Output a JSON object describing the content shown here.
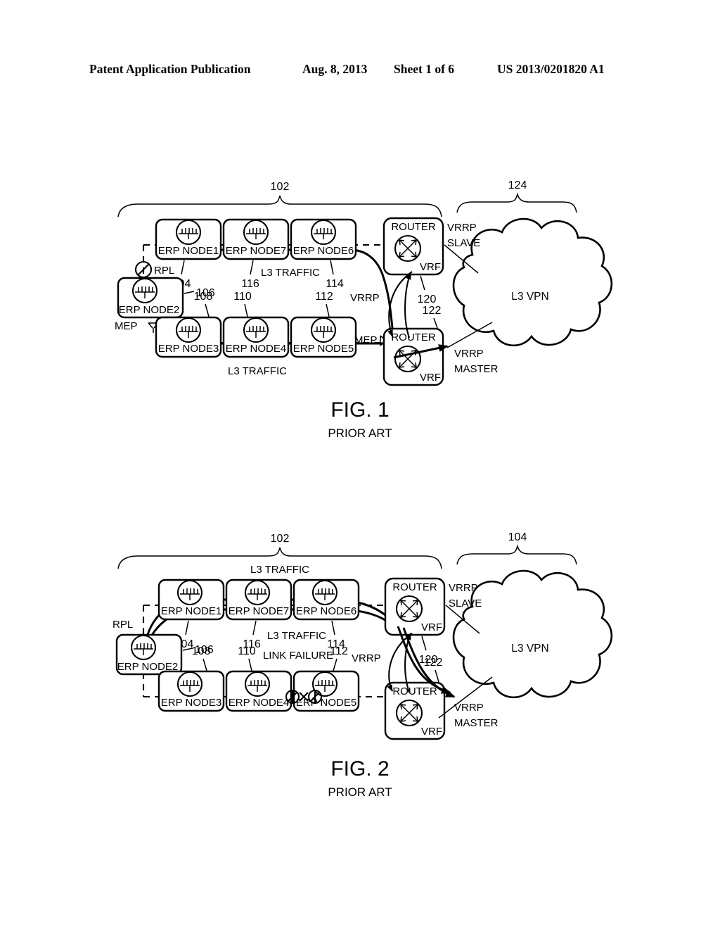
{
  "header": {
    "publication": "Patent Application Publication",
    "date": "Aug. 8, 2013",
    "sheet": "Sheet 1 of 6",
    "patent_number": "US 2013/0201820 A1"
  },
  "figures": [
    {
      "id": "fig1",
      "caption": "FIG. 1",
      "caption_sub": "PRIOR ART",
      "ring_ref": "102",
      "cloud_ref": "124",
      "cloud_label": "L3 VPN",
      "rpl_label": "RPL",
      "vrrp_label": "VRRP",
      "vrrp_slave": "VRRP\nSLAVE",
      "vrrp_slave_line1": "VRRP",
      "vrrp_slave_line2": "SLAVE",
      "vrrp_master_line1": "VRRP",
      "vrrp_master_line2": "MASTER",
      "mep_left": "MEP",
      "mep_right": "MEP",
      "traffic_label_top": "L3 TRAFFIC",
      "traffic_label_bottom": "L3 TRAFFIC",
      "nodes_top": [
        {
          "label": "ERP NODE1",
          "ref": "104"
        },
        {
          "label": "ERP NODE7",
          "ref": "116"
        },
        {
          "label": "ERP NODE6",
          "ref": "114"
        }
      ],
      "nodes_bottom": [
        {
          "label": "ERP NODE3",
          "ref": "108"
        },
        {
          "label": "ERP NODE4",
          "ref": "110"
        },
        {
          "label": "ERP NODE5",
          "ref": "112"
        }
      ],
      "node_left": {
        "label": "ERP NODE2",
        "ref": "106"
      },
      "routers": [
        {
          "label": "ROUTER",
          "vrf": "VRF",
          "ref": "120"
        },
        {
          "label": "ROUTER",
          "vrf": "VRF",
          "ref": "122"
        }
      ]
    },
    {
      "id": "fig2",
      "caption": "FIG. 2",
      "caption_sub": "PRIOR ART",
      "ring_ref": "102",
      "cloud_ref": "104",
      "cloud_label": "L3 VPN",
      "rpl_label": "RPL",
      "vrrp_label": "VRRP",
      "vrrp_slave_line1": "VRRP",
      "vrrp_slave_line2": "SLAVE",
      "vrrp_master_line1": "VRRP",
      "vrrp_master_line2": "MASTER",
      "traffic_label_above": "L3 TRAFFIC",
      "traffic_label_mid": "L3 TRAFFIC",
      "link_failure_label": "LINK FAILURE",
      "nodes_top": [
        {
          "label": "ERP NODE1",
          "ref": "104"
        },
        {
          "label": "ERP NODE7",
          "ref": "116"
        },
        {
          "label": "ERP NODE6",
          "ref": "114"
        }
      ],
      "nodes_bottom": [
        {
          "label": "ERP NODE3",
          "ref": "108"
        },
        {
          "label": "ERP NODE4",
          "ref": "110"
        },
        {
          "label": "ERP NODE5",
          "ref": "112"
        }
      ],
      "node_left": {
        "label": "ERP NODE2",
        "ref": "106"
      },
      "routers": [
        {
          "label": "ROUTER",
          "vrf": "VRF",
          "ref": "120"
        },
        {
          "label": "ROUTER",
          "vrf": "VRF",
          "ref": "122"
        }
      ]
    }
  ]
}
